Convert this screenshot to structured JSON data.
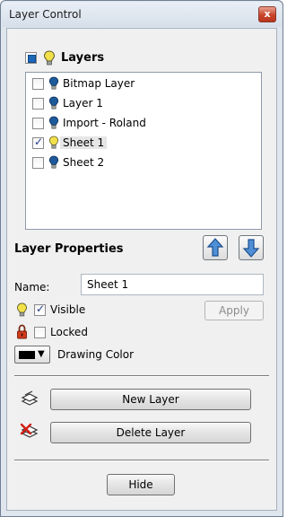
{
  "window": {
    "title": "Layer Control",
    "close_glyph": "x"
  },
  "layers_header": {
    "label": "Layers",
    "checkbox_state": "indeterminate"
  },
  "layers": [
    {
      "name": "Bitmap Layer",
      "checked": false,
      "bulb_color": "#1d5a9a"
    },
    {
      "name": "Layer 1",
      "checked": false,
      "bulb_color": "#1d5a9a"
    },
    {
      "name": "Import - Roland",
      "checked": false,
      "bulb_color": "#1d5a9a"
    },
    {
      "name": "Sheet 1",
      "checked": true,
      "bulb_color": "#f2e04a",
      "selected": true
    },
    {
      "name": "Sheet 2",
      "checked": false,
      "bulb_color": "#1d5a9a"
    }
  ],
  "properties": {
    "title": "Layer Properties",
    "name_label": "Name:",
    "name_value": "Sheet 1",
    "visible_label": "Visible",
    "visible_checked": true,
    "locked_label": "Locked",
    "locked_checked": false,
    "apply_label": "Apply",
    "drawing_color_label": "Drawing Color",
    "drawing_color": "#000000"
  },
  "actions": {
    "new_layer": "New Layer",
    "delete_layer": "Delete Layer",
    "hide": "Hide"
  },
  "icons": {
    "move_up": "arrow-up-icon",
    "move_down": "arrow-down-icon",
    "visible": "lightbulb-icon",
    "locked": "lock-icon",
    "new_layer": "new-layer-icon",
    "delete_layer": "delete-layer-icon"
  }
}
